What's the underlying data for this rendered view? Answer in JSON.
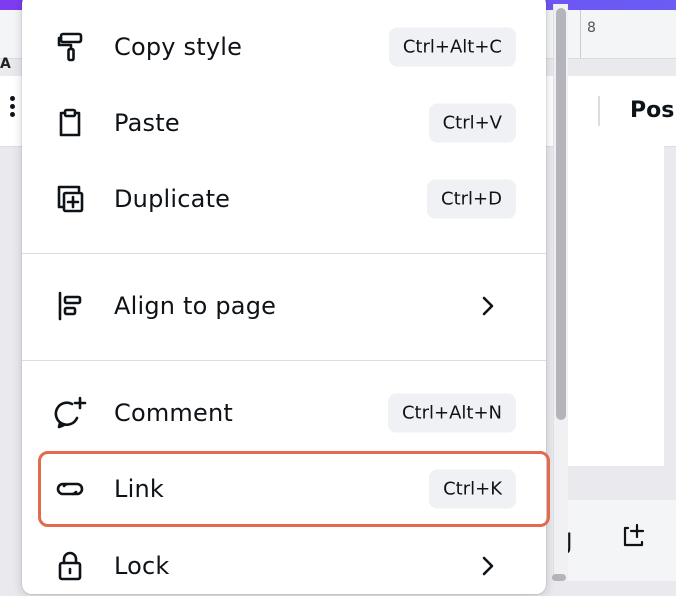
{
  "background": {
    "ruler_number": "8",
    "toolbar_text": "Pos",
    "left_partial_label": "A"
  },
  "menu": {
    "items": [
      {
        "label": "Copy style",
        "shortcut": "Ctrl+Alt+C",
        "icon": "paint-roller-icon"
      },
      {
        "label": "Paste",
        "shortcut": "Ctrl+V",
        "icon": "clipboard-icon"
      },
      {
        "label": "Duplicate",
        "shortcut": "Ctrl+D",
        "icon": "duplicate-icon"
      },
      {
        "label": "Align to page",
        "icon": "align-left-icon",
        "submenu": true
      },
      {
        "label": "Comment",
        "shortcut": "Ctrl+Alt+N",
        "icon": "comment-add-icon"
      },
      {
        "label": "Link",
        "shortcut": "Ctrl+K",
        "icon": "link-icon"
      },
      {
        "label": "Lock",
        "icon": "lock-icon",
        "submenu": true
      }
    ]
  },
  "colors": {
    "highlight": "#e46a4e",
    "accent": "#7d3cf0",
    "shortcut_bg": "#f0f1f5",
    "text": "#0e1318"
  }
}
